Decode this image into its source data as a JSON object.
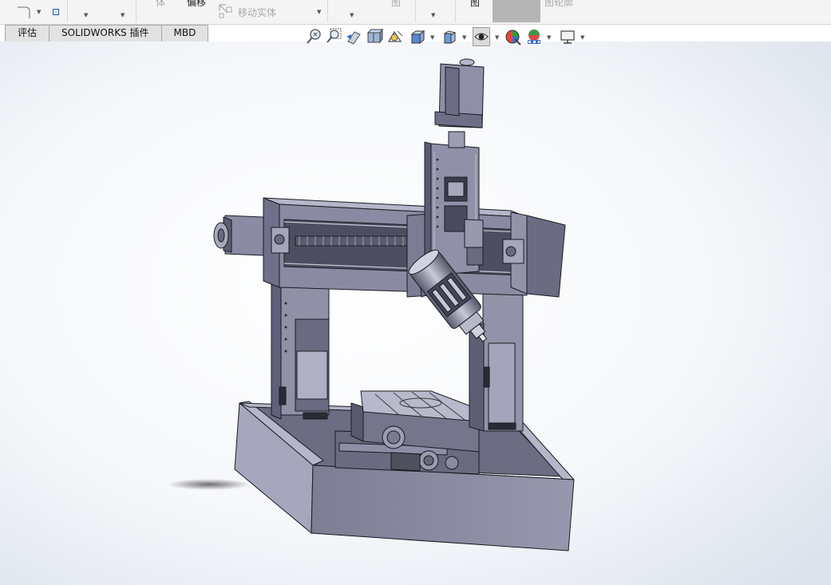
{
  "ribbon": {
    "body_label": "体",
    "offset_label": "偏移",
    "move_body_label": "移动实体",
    "drawing_label": "图",
    "view_label": "图",
    "outline_label": "图轮廓"
  },
  "tabs": [
    "评估",
    "SOLIDWORKS 插件",
    "MBD"
  ],
  "heads_up_toolbar": [
    "zoom-to-fit-icon",
    "zoom-to-area-icon",
    "previous-view-icon",
    "section-view-icon",
    "dynamic-annotation-icon",
    "view-orientation-icon",
    "display-style-icon",
    "hide-show-items-icon",
    "edit-appearance-icon",
    "apply-scene-icon",
    "view-settings-icon"
  ],
  "colors": {
    "ribbon_bg": "#f4f4f4",
    "tab_bg": "#e2e2e2",
    "viewport_center": "#ffffff",
    "viewport_edge": "#dde3ec",
    "model_face": "#8f8fa6",
    "model_face_dark": "#606074",
    "model_face_light": "#b2b2c6",
    "model_edge": "#1a1a22"
  }
}
